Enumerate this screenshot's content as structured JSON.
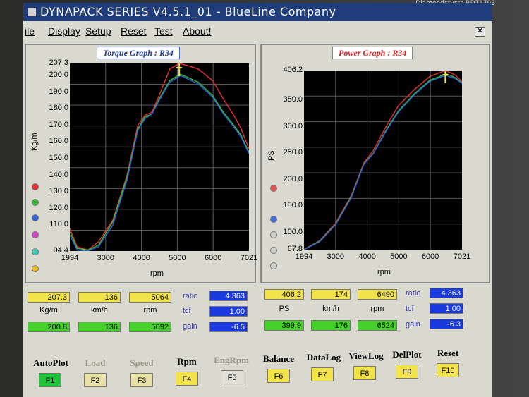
{
  "monitor": {
    "brand": "Diamondcrysta RDT179S"
  },
  "window": {
    "title": "DYNAPACK SERIES V4.5.1_01  - BlueLine Company",
    "close_glyph": "✕"
  },
  "menu": [
    "ile",
    "Display",
    "Setup",
    "Reset",
    "Test",
    "About!"
  ],
  "left": {
    "title": "Torque Graph : R34",
    "ylabel": "Kg/m",
    "xlabel": "rpm",
    "yticks": [
      "207.3",
      "200.0",
      "190.0",
      "180.0",
      "170.0",
      "160.0",
      "150.0",
      "140.0",
      "130.0",
      "120.0",
      "110.0",
      "94.4"
    ],
    "xticks": [
      "1994",
      "3000",
      "4000",
      "5000",
      "6000",
      "7021"
    ],
    "values": {
      "a": "207.3",
      "b": "136",
      "c": "5064"
    },
    "units": {
      "a": "Kg/m",
      "b": "km/h",
      "c": "rpm"
    },
    "values2": {
      "a": "200.8",
      "b": "136",
      "c": "5092"
    },
    "params": {
      "ratio_label": "ratio",
      "ratio": "4.363",
      "tcf_label": "tcf",
      "tcf": "1.00",
      "gain_label": "gain",
      "gain": "-6.5"
    }
  },
  "right": {
    "title": "Power Graph : R34",
    "ylabel": "PS",
    "xlabel": "rpm",
    "yticks": [
      "406.2",
      "350.0",
      "300.0",
      "250.0",
      "200.0",
      "150.0",
      "100.0",
      "67.8"
    ],
    "xticks": [
      "1994",
      "3000",
      "4000",
      "5000",
      "6000",
      "7021"
    ],
    "values": {
      "a": "406.2",
      "b": "174",
      "c": "6490"
    },
    "units": {
      "a": "PS",
      "b": "km/h",
      "c": "rpm"
    },
    "values2": {
      "a": "399.9",
      "b": "176",
      "c": "6524"
    },
    "params": {
      "ratio_label": "ratio",
      "ratio": "4.363",
      "tcf_label": "tcf",
      "tcf": "1.00",
      "gain_label": "gain",
      "gain": "-6.3"
    }
  },
  "fkeys": [
    {
      "name": "AutoPlot",
      "key": "F1",
      "color": "#1fc43a"
    },
    {
      "name": "Load",
      "key": "F2",
      "color": "#e9e2a8"
    },
    {
      "name": "Speed",
      "key": "F3",
      "color": "#e9e2a8"
    },
    {
      "name": "Rpm",
      "key": "F4",
      "color": "#f3e34a"
    },
    {
      "name": "EngRpm",
      "key": "F5",
      "color": "#e0e0d6"
    },
    {
      "name": "Balance",
      "key": "F6",
      "color": "#f3e34a"
    },
    {
      "name": "DataLog",
      "key": "F7",
      "color": "#f3e34a"
    },
    {
      "name": "ViewLog",
      "key": "F8",
      "color": "#f3e34a"
    },
    {
      "name": "DelPlot",
      "key": "F9",
      "color": "#f3e34a"
    },
    {
      "name": "Reset",
      "key": "F10",
      "color": "#f3e34a"
    }
  ],
  "chart_data": [
    {
      "type": "line",
      "title": "Torque Graph : R34",
      "xlabel": "rpm",
      "ylabel": "Kg/m",
      "xlim": [
        1994,
        7021
      ],
      "ylim": [
        94.4,
        207.3
      ],
      "series": [
        {
          "color": "#e83030",
          "x": [
            1994,
            2200,
            2500,
            2800,
            3200,
            3600,
            3900,
            4100,
            4300,
            4500,
            4800,
            5064,
            5300,
            5600,
            6000,
            6300,
            6600,
            6800,
            7021
          ],
          "y": [
            108,
            97,
            95,
            100,
            113,
            140,
            170,
            176,
            178,
            188,
            204,
            207.3,
            206,
            204,
            197,
            186,
            176,
            168,
            156
          ]
        },
        {
          "color": "#30c030",
          "x": [
            1994,
            2200,
            2500,
            2800,
            3200,
            3600,
            3900,
            4100,
            4300,
            4500,
            4800,
            5092,
            5300,
            5600,
            6000,
            6300,
            6600,
            6800,
            7021
          ],
          "y": [
            106,
            96,
            95,
            98,
            112,
            139,
            168,
            175,
            177,
            186,
            197,
            200.8,
            199,
            196,
            188,
            178,
            170,
            164,
            154
          ]
        },
        {
          "color": "#3060e0",
          "x": [
            1994,
            2200,
            2500,
            2800,
            3200,
            3600,
            3900,
            4100,
            4300,
            4500,
            4800,
            5100,
            5300,
            5600,
            6000,
            6300,
            6600,
            6800,
            7021
          ],
          "y": [
            104,
            95,
            94.5,
            97,
            110,
            137,
            167,
            174,
            177,
            185,
            196,
            200,
            198,
            195,
            187,
            177,
            169,
            163,
            153
          ]
        }
      ]
    },
    {
      "type": "line",
      "title": "Power Graph : R34",
      "xlabel": "rpm",
      "ylabel": "PS",
      "xlim": [
        1994,
        7021
      ],
      "ylim": [
        67.8,
        406.2
      ],
      "series": [
        {
          "color": "#e83030",
          "x": [
            1994,
            2500,
            3000,
            3500,
            3900,
            4200,
            4600,
            5000,
            5500,
            6000,
            6490,
            6800,
            7021
          ],
          "y": [
            68,
            85,
            118,
            170,
            232,
            255,
            300,
            340,
            370,
            395,
            406.2,
            398,
            385
          ]
        },
        {
          "color": "#30c030",
          "x": [
            1994,
            2500,
            3000,
            3500,
            3900,
            4200,
            4600,
            5000,
            5500,
            6000,
            6524,
            6800,
            7021
          ],
          "y": [
            67.8,
            84,
            116,
            168,
            230,
            250,
            293,
            330,
            362,
            388,
            399.9,
            393,
            383
          ]
        },
        {
          "color": "#3060e0",
          "x": [
            1994,
            2500,
            3000,
            3500,
            3900,
            4200,
            4600,
            5000,
            5500,
            6000,
            6500,
            6800,
            7021
          ],
          "y": [
            67.8,
            83,
            115,
            166,
            229,
            249,
            291,
            328,
            360,
            386,
            397,
            391,
            382
          ]
        }
      ]
    }
  ]
}
